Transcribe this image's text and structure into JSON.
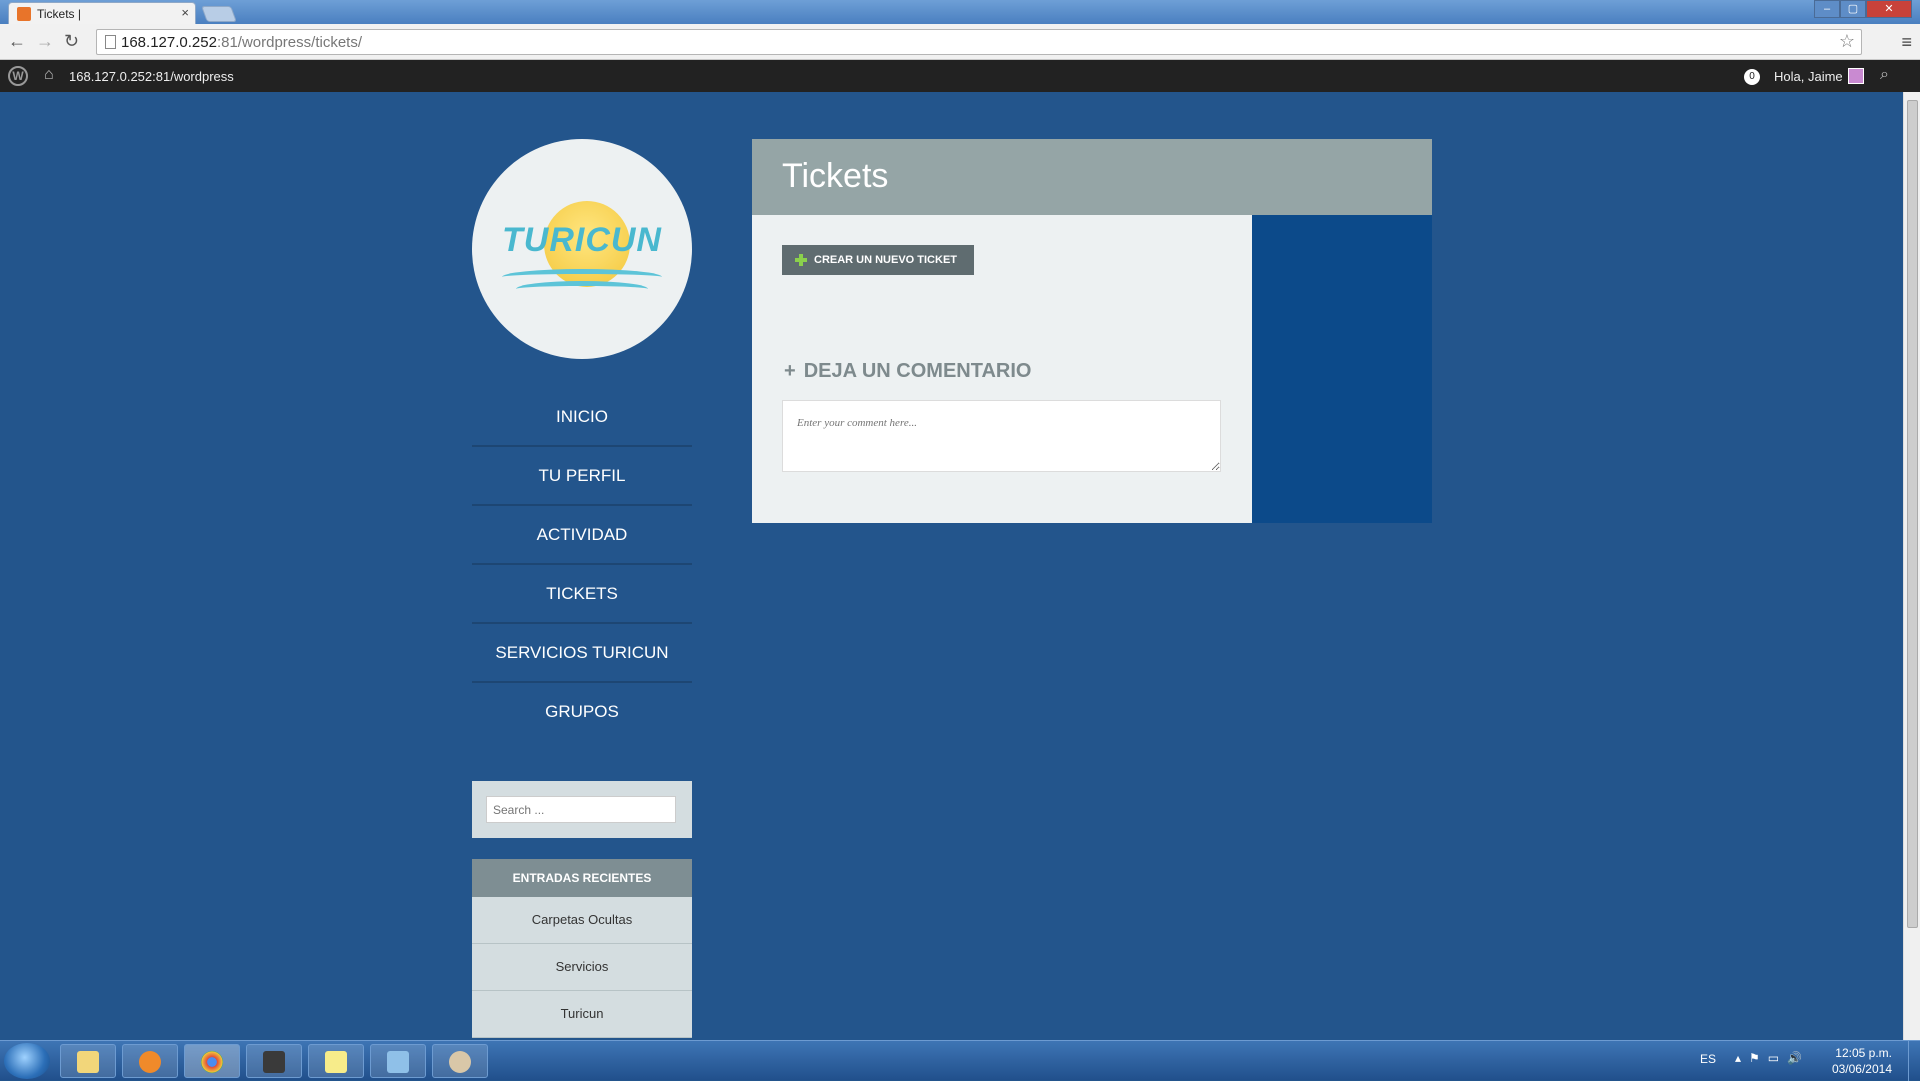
{
  "browser": {
    "tab_title": "Tickets |",
    "tab_close": "×",
    "url_host": "168.127.0.252",
    "url_rest": ":81/wordpress/tickets/"
  },
  "adminbar": {
    "site_name": "168.127.0.252:81/wordpress",
    "notifications": "0",
    "howdy": "Hola, Jaime"
  },
  "logo": {
    "text": "TURICUN"
  },
  "nav": {
    "items": [
      "INICIO",
      "TU PERFIL",
      "ACTIVIDAD",
      "TICKETS",
      "SERVICIOS TURICUN",
      "GRUPOS"
    ]
  },
  "search": {
    "placeholder": "Search ..."
  },
  "recent": {
    "heading": "ENTRADAS RECIENTES",
    "items": [
      "Carpetas Ocultas",
      "Servicios",
      "Turicun"
    ]
  },
  "main": {
    "title": "Tickets",
    "new_ticket_label": "CREAR UN NUEVO TICKET",
    "comment_heading": "DEJA UN COMENTARIO",
    "comment_plus": "+",
    "comment_placeholder": "Enter your comment here..."
  },
  "taskbar": {
    "language": "ES",
    "time": "12:05 p.m.",
    "date": "03/06/2014"
  },
  "colors": {
    "page_bg": "#23558c",
    "title_bar": "#95a5a6",
    "content_bg": "#edf1f2",
    "sidebar_panel": "#0c4a8a",
    "button_bg": "#5f6c70"
  }
}
